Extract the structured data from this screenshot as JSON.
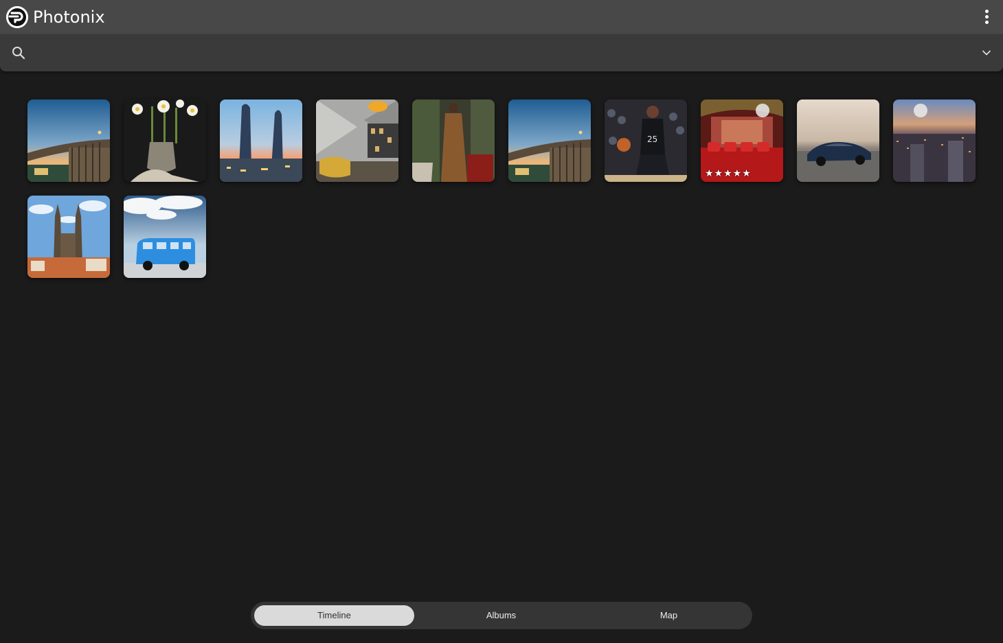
{
  "header": {
    "title": "Photonix",
    "logo_icon": "photonix-logo-icon",
    "menu_icon": "more-vert-icon"
  },
  "search": {
    "icon": "search-icon",
    "value": "",
    "placeholder": "",
    "expand_icon": "chevron-down-icon"
  },
  "photos": [
    {
      "subject": "bridge-at-dusk"
    },
    {
      "subject": "daffodils-in-vase"
    },
    {
      "subject": "twin-towers-sunset"
    },
    {
      "subject": "office-lounge"
    },
    {
      "subject": "fashion-model"
    },
    {
      "subject": "bridge-at-dusk"
    },
    {
      "subject": "basketball-player"
    },
    {
      "subject": "red-theater",
      "stars": "★★★★★"
    },
    {
      "subject": "blue-car"
    },
    {
      "subject": "city-aerial-night"
    },
    {
      "subject": "gothic-church"
    },
    {
      "subject": "blue-vw-van"
    }
  ],
  "nav": {
    "tabs": [
      {
        "label": "Timeline",
        "active": true
      },
      {
        "label": "Albums",
        "active": false
      },
      {
        "label": "Map",
        "active": false
      }
    ]
  },
  "colors": {
    "header_bg": "#484848",
    "searchbar_bg": "#3a3a3a",
    "page_bg": "#1b1b1b",
    "nav_bg": "#353535",
    "nav_active_bg": "#dadada"
  }
}
